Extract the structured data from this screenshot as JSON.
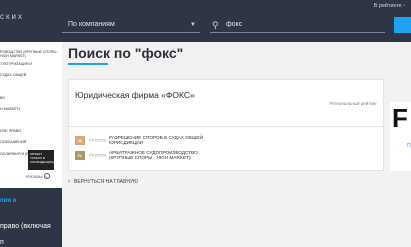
{
  "header": {
    "logo": "ских",
    "rating_link": "В рейтинге",
    "rating_link_suffix": "•",
    "company_select": "По компаниям",
    "search_value": "фокс"
  },
  "sidebar": {
    "items": [
      {
        "label": "ровоДСТВО (КРУПНЫЕ СПОРЫ - HIGH MARKET)"
      },
      {
        "label": "ТУКТУРИЗАЦИЯ И"
      },
      {
        "label": "СУДАХ ОБЩЕЙ"
      },
      {
        "label": "ВО"
      },
      {
        "label": "H MARKET)"
      },
      {
        "label": "НОЕ ПРАВО"
      },
      {
        "label": "ооБЛАЖЕНИЯ"
      },
      {
        "label": "ОСЛИЯНИЯ И (ET)"
      }
    ],
    "badge_text": "ОБЪЕКТ ТОЛЬКО В КОНФИДЕНЦИАЛЬНОСТИ",
    "reklama": "РЕКЛАМА",
    "dark_heading": "пии и",
    "dark_item1": "право (включая",
    "dark_item2": "п"
  },
  "page": {
    "title": "Поиск по \"фокс\""
  },
  "result": {
    "company_name": "Юридическая фирма «ФОКС»",
    "regional_rating": "Региональный рейтинг",
    "rows": [
      {
        "badge": "III",
        "group": "ГРУППА",
        "text": "РАЗРЕШЕНИЕ СПОРОВ В СУДАХ ОБЩЕЙ ЮРИСДИКЦИИ",
        "color": "#d9a77a"
      },
      {
        "badge": "IV",
        "group": "ГРУППА",
        "text": "АРБИТРАЖНОЕ СУДОПРОИЗВОДСТВО (КРУПНЫЕ СПОРЫ - HIGH MARKET)",
        "color": "#a99a6a"
      }
    ]
  },
  "side_panel": {
    "letter": "F",
    "link": "П"
  },
  "back_link": "ВЕРНУТЬСЯ НА ГЛАВНУЮ",
  "colors": {
    "accent": "#1ea1f2",
    "topbar": "#2e3645"
  }
}
